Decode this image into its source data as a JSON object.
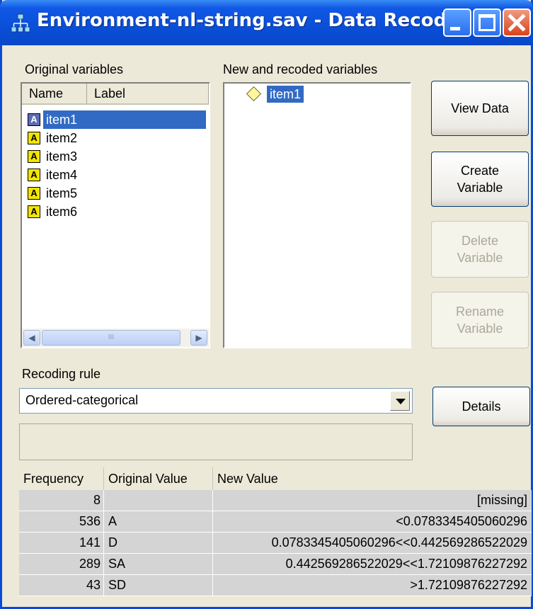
{
  "window": {
    "title": "Environment-nl-string.sav - Data Recode"
  },
  "original_variables": {
    "label": "Original variables",
    "columns": [
      "Name",
      "Label"
    ],
    "items": [
      "item1",
      "item2",
      "item3",
      "item4",
      "item5",
      "item6"
    ],
    "selected": "item1",
    "scroll_thumb_grip": "III"
  },
  "new_variables": {
    "label": "New and recoded variables",
    "items": [
      "item1"
    ]
  },
  "buttons": {
    "view_data": "View Data",
    "create_variable_1": "Create",
    "create_variable_2": "Variable",
    "delete_variable_1": "Delete",
    "delete_variable_2": "Variable",
    "rename_variable_1": "Rename",
    "rename_variable_2": "Variable",
    "details": "Details"
  },
  "recoding": {
    "label": "Recoding rule",
    "selected": "Ordered-categorical"
  },
  "table": {
    "columns": [
      "Frequency",
      "Original Value",
      "New Value"
    ],
    "rows": [
      {
        "frequency": "8",
        "original": "",
        "new": "[missing]"
      },
      {
        "frequency": "536",
        "original": "A",
        "new": "<0.0783345405060296"
      },
      {
        "frequency": "141",
        "original": "D",
        "new": "0.0783345405060296<<0.442569286522029"
      },
      {
        "frequency": "289",
        "original": "SA",
        "new": "0.442569286522029<<1.72109876227292"
      },
      {
        "frequency": "43",
        "original": "SD",
        "new": ">1.72109876227292"
      }
    ]
  },
  "colors": {
    "titlebar": "#0a4fd8",
    "selection": "#316ac5",
    "variable_icon": "#f2e400",
    "table_row": "#d4d4d4"
  }
}
